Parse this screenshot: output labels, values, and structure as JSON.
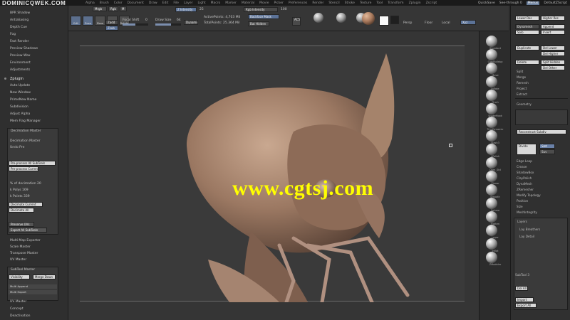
{
  "watermark_top": "DOMINICQWEK.COM",
  "watermark_mid": "www.cgtsj.com",
  "menubar": [
    "Alpha",
    "Brush",
    "Color",
    "Document",
    "Draw",
    "Edit",
    "File",
    "Layer",
    "Light",
    "Macro",
    "Marker",
    "Material",
    "Movie",
    "Picker",
    "Preferences",
    "Render",
    "Stencil",
    "Stroke",
    "Texture",
    "Tool",
    "Transform",
    "Zplugin",
    "Zscript"
  ],
  "menu_right": {
    "quicksave": "QuickSave",
    "see_through": "See-through 0",
    "menus": "Menus",
    "default_script": "DefaultZScript"
  },
  "shelf": {
    "edit": "Edit",
    "draw": "Draw",
    "move": "Move",
    "scale": "Scale",
    "rotate": "Rotate",
    "mrgb": "Mrgb",
    "rgb": "Rgb",
    "m": "M",
    "zadd": "Zadd",
    "zsub": "Zsub",
    "zcut": "Zcut",
    "focal_label": "Focal Shift",
    "focal_value": "0",
    "z_intensity_label": "Z Intensity",
    "z_intensity_value": "25",
    "draw_size_label": "Draw Size",
    "draw_size_value": "64",
    "dynamic": "Dynamic",
    "active_points": "ActivePoints: 4,703 Mil",
    "total_points": "TotalPoints: 25.364 Mil",
    "rgb_intensity_label": "Rgb Intensity",
    "rgb_intensity_value": "100",
    "ac50": "AC50",
    "backface": "Backface Mask",
    "subtool": "Bat Hidden",
    "persp": "Persp",
    "floor": "Floor",
    "local": "Local",
    "xyz": "Xyz"
  },
  "left_panel": {
    "items_top": [
      "BPR Shadow",
      "Antialiasing",
      "Depth Cue",
      "Fog",
      "Fast Render",
      "Preview Shadows",
      "Preview Wax",
      "Environment",
      "Adjustments"
    ],
    "zplugin": "Zplugin",
    "items_mid": [
      "Auto Update",
      "New Window",
      "PrimeNew Name",
      "Subdivision",
      "Adjust Alpha",
      "Mem Flag Manager"
    ],
    "box_title": "Decimation Master",
    "box_items": [
      "Decimation Master",
      "Undo Pre"
    ],
    "btn1": "Pre-process All SubTools",
    "btn2": "Pre-process Current",
    "pct_label": "% of decimation 20",
    "kpoly_label": "k Polys 169",
    "kpts_label": "k Points 339",
    "btn3": "Decimate Current",
    "btn4": "Decimate All",
    "btn5": "Preserve UVs",
    "btn6": "Export All SubTools",
    "items_low": [
      "Multi Map Exporter",
      "Scale Master",
      "Transpose Master",
      "UV Master"
    ],
    "box2_title": "SubTool Master",
    "box2_b1": "Visibility",
    "box2_b2": "Merge Down",
    "box2_b3": "Multi Append",
    "box2_b4": "Multi Export",
    "items_bottom": [
      "UV Master",
      "Concept",
      "Deactivation"
    ]
  },
  "right_panel": {
    "top_buttons": [
      "Lower Res",
      "Higher Res",
      "Dynamesh",
      "Append",
      "Solo",
      "Insert",
      "Del Lower",
      "Del Higher",
      "Duplicate",
      "Delete",
      "Split Hidden",
      "Del Other"
    ],
    "items": [
      "Split",
      "Merge",
      "Remesh",
      "Project",
      "Extract"
    ],
    "section_title": "Geometry",
    "geom_btn": "Reconstruct Subdiv",
    "divide_btn": "Divide",
    "smt": "Smt",
    "suv": "Suv",
    "items2": [
      "Edge Loop",
      "Crease",
      "ShadowBox",
      "ClayPolish",
      "DynaMesh",
      "ZRemesher",
      "Modify Topology",
      "Position",
      "Size",
      "MeshIntegrity"
    ],
    "layers_title": "Layers",
    "layer1": "Lay Breathers",
    "layer2": "Lay Detail",
    "bottom_label": "SubTool 3",
    "bottom_btns": [
      "Del All",
      "Bake All",
      "Solo"
    ],
    "bottom_last": "Import",
    "bottom_last2": "Export All"
  },
  "brush_col": {
    "labels": [
      "Standard",
      "ClayBuildup",
      "Move",
      "Inflate",
      "Pinch",
      "SnakeHook",
      "TrimDynamic",
      "Slash3",
      "hPolish",
      "Dam_Std",
      "Planar",
      "Smooth",
      "Sphere",
      "Flatten",
      "Layer",
      "Inflat",
      "ZModeler"
    ],
    "gear_label": "Default",
    "last_btn": "Texture"
  }
}
